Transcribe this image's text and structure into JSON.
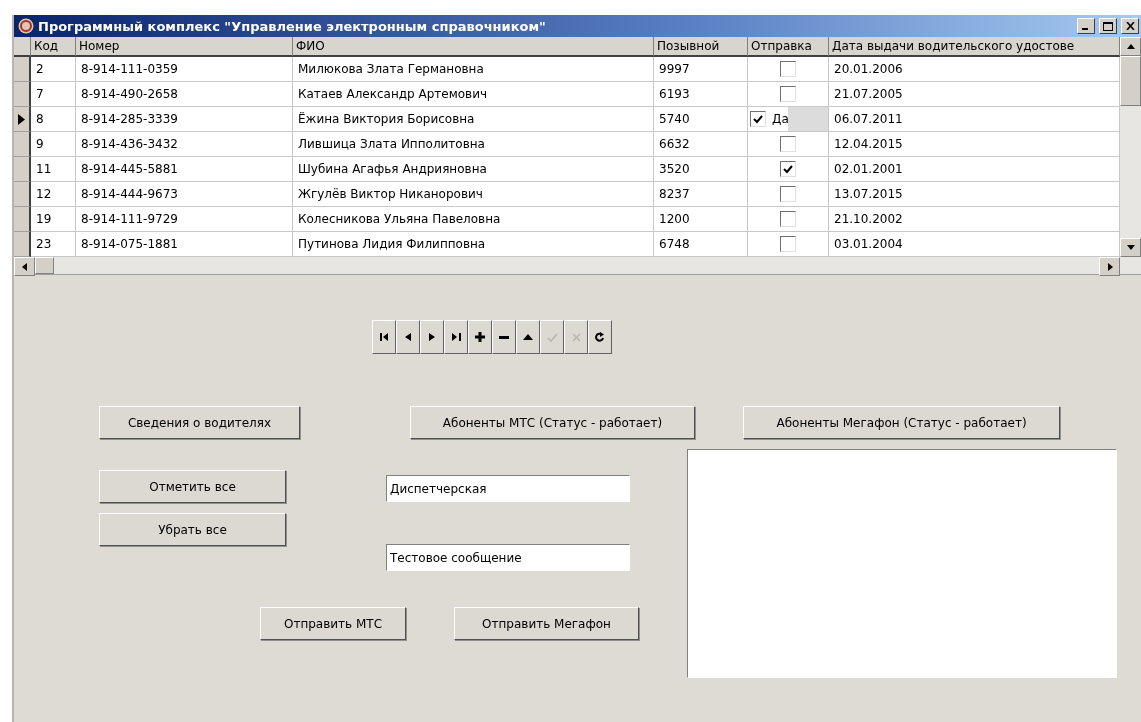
{
  "window": {
    "title": "Программный комплекс \"Управление электронным справочником\""
  },
  "table": {
    "columns": [
      "Код",
      "Номер",
      "ФИО",
      "Позывной",
      "Отправка",
      "Дата выдачи водительского удостове"
    ],
    "rows": [
      {
        "code": "2",
        "phone": "8-914-111-0359",
        "name": "Милюкова Злата Германовна",
        "callsign": "9997",
        "send": false,
        "date": "20.01.2006",
        "selected": false
      },
      {
        "code": "7",
        "phone": "8-914-490-2658",
        "name": "Катаев Александр Артемович",
        "callsign": "6193",
        "send": false,
        "date": "21.07.2005",
        "selected": false
      },
      {
        "code": "8",
        "phone": "8-914-285-3339",
        "name": "Ёжина Виктория Борисовна",
        "callsign": "5740",
        "send": true,
        "check_label": "Да",
        "date": "06.07.2011",
        "selected": true
      },
      {
        "code": "9",
        "phone": "8-914-436-3432",
        "name": "Лившица Злата Ипполитовна",
        "callsign": "6632",
        "send": false,
        "date": "12.04.2015",
        "selected": false
      },
      {
        "code": "11",
        "phone": "8-914-445-5881",
        "name": "Шубина Агафья Андрияновна",
        "callsign": "3520",
        "send": true,
        "date": "02.01.2001",
        "selected": false
      },
      {
        "code": "12",
        "phone": "8-914-444-9673",
        "name": "Жгулёв Виктор Никанорович",
        "callsign": "8237",
        "send": false,
        "date": "13.07.2015",
        "selected": false
      },
      {
        "code": "19",
        "phone": "8-914-111-9729",
        "name": "Колесникова Ульяна Павеловна",
        "callsign": "1200",
        "send": false,
        "date": "21.10.2002",
        "selected": false
      },
      {
        "code": "23",
        "phone": "8-914-075-1881",
        "name": "Путинова Лидия Филипповна",
        "callsign": "6748",
        "send": false,
        "date": "03.01.2004",
        "selected": false
      }
    ]
  },
  "navigator": [
    {
      "kind": "first",
      "disabled": false
    },
    {
      "kind": "prior",
      "disabled": false
    },
    {
      "kind": "next",
      "disabled": false
    },
    {
      "kind": "last",
      "disabled": false
    },
    {
      "kind": "insert",
      "disabled": false
    },
    {
      "kind": "delete",
      "disabled": false
    },
    {
      "kind": "edit",
      "disabled": false
    },
    {
      "kind": "post",
      "disabled": true
    },
    {
      "kind": "cancel",
      "disabled": true
    },
    {
      "kind": "refresh",
      "disabled": false
    }
  ],
  "buttons_top": [
    "Сведения о водителях",
    "Абоненты МТС (Статус - работает)",
    "Абоненты Мегафон (Статус - работает)"
  ],
  "mark_buttons": [
    "Отметить все",
    "Убрать все"
  ],
  "fields": [
    {
      "value": "Диспетчерская"
    },
    {
      "value": "Тестовое сообщение"
    }
  ],
  "send_buttons": [
    "Отправить МТС",
    "Отправить Мегафон"
  ]
}
